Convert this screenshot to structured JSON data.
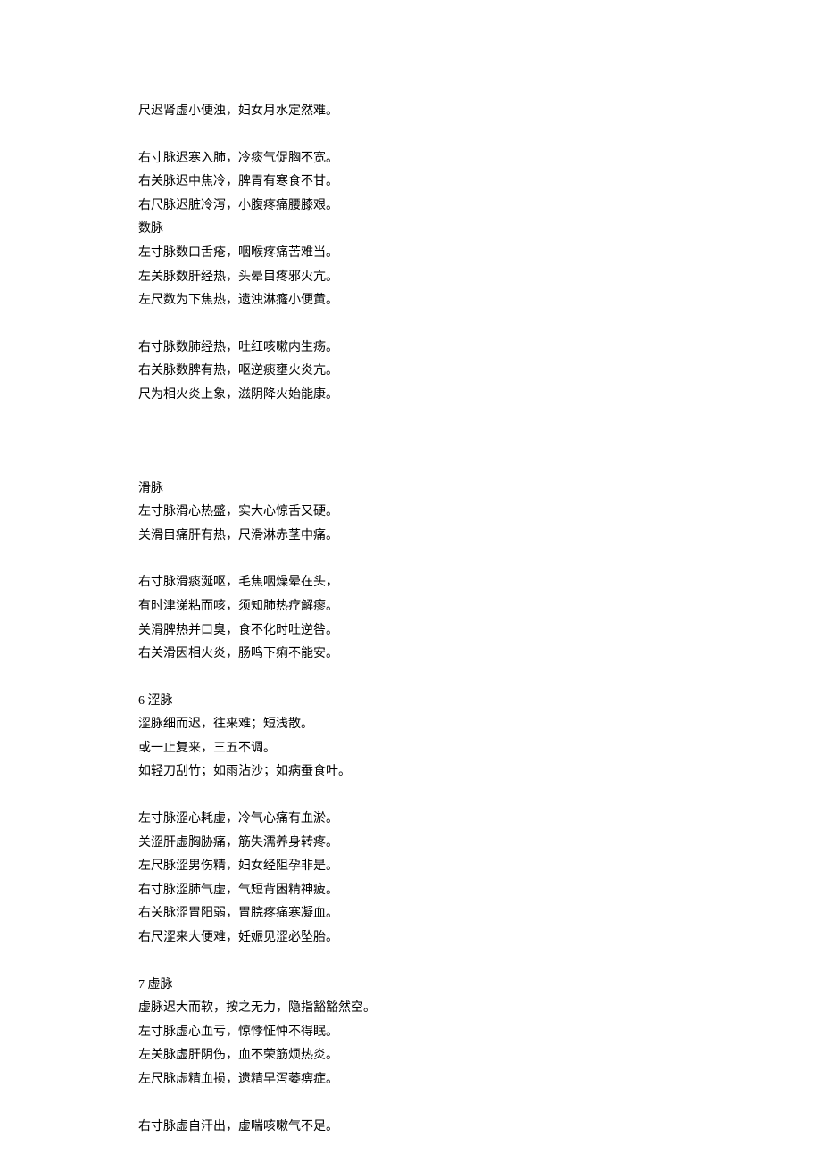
{
  "sections": [
    {
      "lines": [
        "尺迟肾虚小便浊，妇女月水定然难。"
      ]
    },
    {
      "lines": [
        "右寸脉迟寒入肺，冷痰气促胸不宽。",
        "右关脉迟中焦冷，脾胃有寒食不甘。",
        "右尺脉迟脏冷泻，小腹疼痛腰膝艰。",
        "数脉",
        "左寸脉数口舌疮，咽喉疼痛苦难当。",
        "左关脉数肝经热，头晕目疼邪火亢。",
        "左尺数为下焦热，遗浊淋癃小便黄。"
      ]
    },
    {
      "lines": [
        "右寸脉数肺经热，吐红咳嗽内生疡。",
        "右关脉数脾有热，呕逆痰壅火炎亢。",
        "尺为相火炎上象，滋阴降火始能康。"
      ]
    },
    {
      "bigGap": true,
      "lines": [
        "滑脉",
        "左寸脉滑心热盛，实大心惊舌又硬。",
        "关滑目痛肝有热，尺滑淋赤茎中痛。"
      ]
    },
    {
      "lines": [
        "右寸脉滑痰涎呕，毛焦咽燥晕在头，",
        "有时津涕粘而咳，须知肺热疗解瘳。",
        "关滑脾热并口臭，食不化时吐逆咎。",
        "右关滑因相火炎，肠鸣下痢不能安。"
      ]
    },
    {
      "lines": [
        "6 涩脉",
        "涩脉细而迟，往来难；短浅散。",
        "或一止复来，三五不调。",
        "如轻刀刮竹；如雨沾沙；如病蚕食叶。"
      ]
    },
    {
      "lines": [
        "左寸脉涩心耗虚，冷气心痛有血淤。",
        "关涩肝虚胸胁痛，筋失濡养身转疼。",
        "左尺脉涩男伤精，妇女经阻孕非是。",
        "右寸脉涩肺气虚，气短背困精神疲。",
        "右关脉涩胃阳弱，胃脘疼痛寒凝血。",
        "右尺涩来大便难，妊娠见涩必坠胎。"
      ]
    },
    {
      "lines": [
        "7 虚脉",
        "虚脉迟大而软，按之无力，隐指豁豁然空。",
        "左寸脉虚心血亏，惊悸怔忡不得眠。",
        "左关脉虚肝阴伤，血不荣筋烦热炎。",
        "左尺脉虚精血损，遗精早泻萎痹症。"
      ]
    },
    {
      "lines": [
        "右寸脉虚自汗出，虚喘咳嗽气不足。"
      ]
    }
  ]
}
